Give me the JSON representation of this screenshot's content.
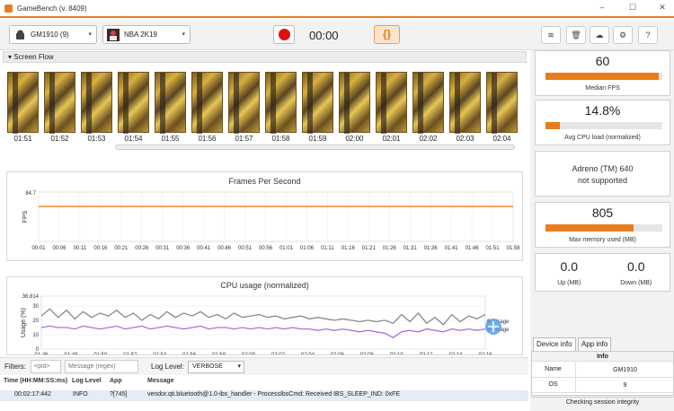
{
  "app": {
    "title": "GameBench (v. 8409)",
    "win_controls": [
      "–",
      "☐",
      "✕"
    ]
  },
  "toolbar": {
    "device": "GM1910 (9)",
    "game": "NBA 2K19",
    "timer": "00:00",
    "brace_label": "{}",
    "icons": [
      "wifi-icon",
      "trash-icon",
      "cloud-upload-icon",
      "settings-icon",
      "help-icon"
    ],
    "icon_glyphs": [
      "≋",
      "🗑",
      "☁",
      "⚙",
      "?"
    ]
  },
  "screen_flow": {
    "title": "Screen Flow",
    "labels": [
      "01:51",
      "01:52",
      "01:53",
      "01:54",
      "01:55",
      "01:56",
      "01:57",
      "01:58",
      "01:59",
      "02:00",
      "02:01",
      "02:02",
      "02:03",
      "02:04"
    ]
  },
  "fps_chart": {
    "title": "Frames Per Second",
    "ylabel": "FPS",
    "ytick": "84.7",
    "xticks": [
      "00:01",
      "00:06",
      "00:11",
      "00:16",
      "00:21",
      "00:26",
      "00:31",
      "00:36",
      "00:41",
      "00:46",
      "00:51",
      "00:56",
      "01:01",
      "01:06",
      "01:11",
      "01:16",
      "01:21",
      "01:26",
      "01:31",
      "01:36",
      "01:41",
      "01:46",
      "01:51",
      "01:58"
    ]
  },
  "cpu_chart": {
    "title": "CPU usage (normalized)",
    "ylabel": "Usage (%)",
    "yticks": [
      "36.814",
      "30",
      "20",
      "10",
      "0"
    ],
    "xticks": [
      "01:46",
      "01:48",
      "01:50",
      "01:52",
      "01:54",
      "01:56",
      "01:58",
      "02:00",
      "02:02",
      "02:04",
      "02:06",
      "02:08",
      "02:10",
      "02:12",
      "02:14",
      "02:16"
    ],
    "legend": [
      "Usage",
      "Usage"
    ]
  },
  "chart_data": [
    {
      "type": "line",
      "title": "Frames Per Second",
      "ylabel": "FPS",
      "ylim": [
        0,
        84.7
      ],
      "x": [
        "00:01",
        "00:06",
        "00:11",
        "00:16",
        "00:21",
        "00:26",
        "00:31",
        "00:36",
        "00:41",
        "00:46",
        "00:51",
        "00:56",
        "01:01",
        "01:06",
        "01:11",
        "01:16",
        "01:21",
        "01:26",
        "01:31",
        "01:36",
        "01:41",
        "01:46",
        "01:51",
        "01:58"
      ],
      "series": [
        {
          "values": [
            60,
            60,
            60,
            60,
            60,
            60,
            60,
            60,
            60,
            60,
            60,
            60,
            60,
            60,
            60,
            60,
            60,
            60,
            60,
            60,
            60,
            60,
            60,
            60
          ]
        }
      ]
    },
    {
      "type": "line",
      "title": "CPU usage (normalized)",
      "ylabel": "Usage (%)",
      "ylim": [
        0,
        36.814
      ],
      "x": [
        "01:46",
        "01:48",
        "01:50",
        "01:52",
        "01:54",
        "01:56",
        "01:58",
        "02:00",
        "02:02",
        "02:04",
        "02:06",
        "02:08",
        "02:10",
        "02:12",
        "02:14",
        "02:16"
      ],
      "series": [
        {
          "name": "Usage",
          "color": "#8a8a8a",
          "values": [
            23,
            28,
            22,
            27,
            21,
            26,
            22,
            25,
            23,
            27,
            22,
            25,
            20,
            24,
            21,
            26,
            22,
            25,
            23,
            26,
            22,
            24,
            21,
            25,
            22,
            23,
            24,
            22,
            23,
            21,
            22,
            23,
            21,
            22,
            21,
            20,
            21,
            20,
            19,
            20,
            19,
            20,
            18,
            24,
            19,
            25,
            18,
            22,
            17,
            24,
            19,
            23,
            21,
            24
          ]
        },
        {
          "name": "Usage",
          "color": "#b06ed8",
          "values": [
            15,
            16,
            15,
            15,
            14,
            16,
            15,
            14,
            15,
            16,
            14,
            15,
            16,
            14,
            15,
            16,
            15,
            14,
            15,
            16,
            14,
            15,
            15,
            14,
            15,
            14,
            15,
            14,
            15,
            14,
            15,
            14,
            14,
            13,
            14,
            13,
            14,
            13,
            12,
            13,
            12,
            11,
            8,
            12,
            13,
            12,
            14,
            13,
            12,
            14,
            13,
            14,
            13,
            14
          ]
        }
      ]
    }
  ],
  "filters": {
    "label": "Filters:",
    "pid_placeholder": "<pid>",
    "msg_placeholder": "Message (regex)",
    "loglevel_label": "Log Level:",
    "loglevel": "VERBOSE"
  },
  "log": {
    "headers": [
      "Time (HH:MM:SS:ms)",
      "Log Level",
      "App",
      "Message"
    ],
    "rows": [
      [
        "00:02:17:442",
        "INFO",
        "?[745]",
        "vendor.qti.bluetooth@1.0-ibs_handler - ProcessIbsCmd: Received IBS_SLEEP_IND: 0xFE"
      ]
    ]
  },
  "metrics": {
    "median_fps": {
      "value": "60",
      "label": "Median FPS",
      "bar_fraction": 0.97
    },
    "cpu": {
      "value": "14.8%",
      "label": "Avg CPU load (normalized)",
      "bar_fraction": 0.12
    },
    "gpu": {
      "line1": "Adreno (TM) 640",
      "line2": "not supported"
    },
    "memory": {
      "value": "805",
      "label": "Max memory used (MB)",
      "bar_fraction": 0.75
    },
    "up": {
      "value": "0.0",
      "label": "Up (MB)"
    },
    "down": {
      "value": "0.0",
      "label": "Down (MB)"
    }
  },
  "info_tabs": [
    "Device info",
    "App info"
  ],
  "info": {
    "header": "Info",
    "rows": [
      [
        "Name",
        "GM1910"
      ],
      [
        "OS",
        "9"
      ]
    ]
  },
  "status": "Checking session integrity",
  "colors": {
    "accent": "#e87d1e",
    "record": "#e01010",
    "cpu_series": "#b06ed8",
    "cpu_total": "#8a8a8a"
  }
}
